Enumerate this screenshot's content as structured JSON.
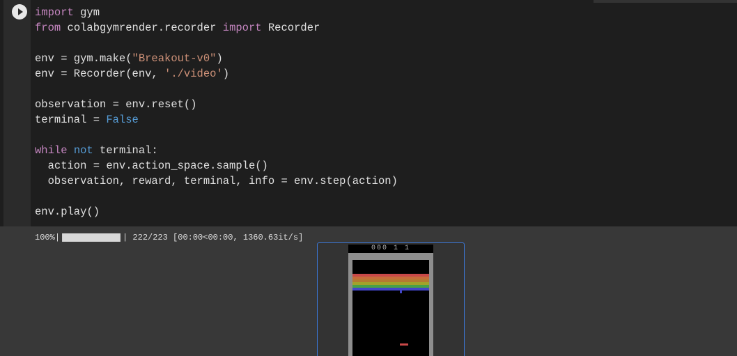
{
  "code": {
    "lines": [
      [
        [
          "k",
          "import"
        ],
        [
          "",
          "gym"
        ]
      ],
      [
        [
          "k",
          "from"
        ],
        [
          "",
          " colabgymrender.recorder "
        ],
        [
          "k",
          "import"
        ],
        [
          "",
          " Recorder"
        ]
      ],
      [],
      [
        [
          "",
          "env = gym.make("
        ],
        [
          "s",
          "\"Breakout-v0\""
        ],
        [
          "",
          ")"
        ]
      ],
      [
        [
          "",
          "env = Recorder(env, "
        ],
        [
          "s",
          "'./video'"
        ],
        [
          "",
          ")"
        ]
      ],
      [],
      [
        [
          "",
          "observation = env.reset()"
        ]
      ],
      [
        [
          "",
          "terminal = "
        ],
        [
          "b",
          "False"
        ]
      ],
      [],
      [
        [
          "k",
          "while"
        ],
        [
          "",
          " "
        ],
        [
          "b",
          "not"
        ],
        [
          "",
          " terminal:"
        ]
      ],
      [
        [
          "",
          "  action = env.action_space.sample()"
        ]
      ],
      [
        [
          "",
          "  observation, reward, terminal, info = env.step(action)"
        ]
      ],
      [],
      [
        [
          "",
          "env.play()"
        ]
      ]
    ]
  },
  "output": {
    "percent": "100%",
    "progress": 100,
    "count": "222/223",
    "timing": "[00:00<00:00, 1360.63it/s]"
  },
  "game": {
    "score": "000  1  1",
    "rows": [
      "#c84848",
      "#c66c3a",
      "#b47a32",
      "#a2a22a",
      "#48a048",
      "#4246c8"
    ]
  },
  "colors": {
    "keyword": "#c586c0",
    "string": "#ce9178",
    "builtin": "#569cd6",
    "video_border": "#3c78d8"
  }
}
